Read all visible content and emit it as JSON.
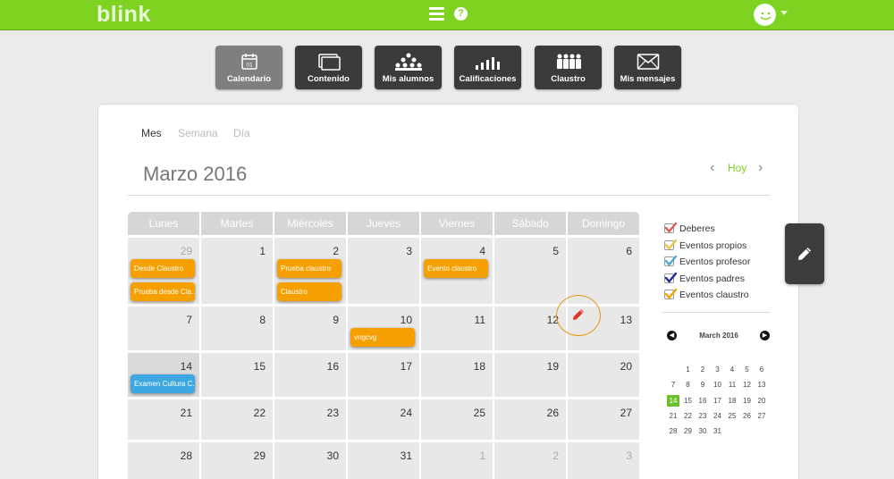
{
  "app": {
    "logo": "blink"
  },
  "nav": {
    "items": [
      {
        "label": "Calendario",
        "icon": "calendar-icon",
        "active": true,
        "icon_text": "01"
      },
      {
        "label": "Contenido",
        "icon": "content-icon",
        "active": false
      },
      {
        "label": "Mis alumnos",
        "icon": "students-icon",
        "active": false
      },
      {
        "label": "Calificaciones",
        "icon": "grades-icon",
        "active": false
      },
      {
        "label": "Claustro",
        "icon": "faculty-icon",
        "active": false
      },
      {
        "label": "Mis mensajes",
        "icon": "messages-icon",
        "active": false
      }
    ]
  },
  "calendar": {
    "views": [
      "Mes",
      "Semana",
      "Día"
    ],
    "active_view": "Mes",
    "title": "Marzo 2016",
    "today_label": "Hoy",
    "weekdays": [
      "Lunes",
      "Martes",
      "Miércoles",
      "Jueves",
      "Viernes",
      "Sábado",
      "Domingo"
    ],
    "weeks": [
      [
        {
          "day": "29",
          "other": true,
          "events": [
            {
              "label": "Desde Claustro",
              "color": "orange"
            },
            {
              "label": "Prueba desde Cla...",
              "color": "orange"
            }
          ]
        },
        {
          "day": "1"
        },
        {
          "day": "2",
          "events": [
            {
              "label": "Prueba claustro",
              "color": "orange"
            },
            {
              "label": "Claustro",
              "color": "orange"
            }
          ]
        },
        {
          "day": "3"
        },
        {
          "day": "4",
          "events": [
            {
              "label": "Evento claustro",
              "color": "orange"
            }
          ]
        },
        {
          "day": "5"
        },
        {
          "day": "6"
        }
      ],
      [
        {
          "day": "7"
        },
        {
          "day": "8"
        },
        {
          "day": "9"
        },
        {
          "day": "10",
          "events": [
            {
              "label": "vngcvg",
              "color": "orange"
            }
          ]
        },
        {
          "day": "11"
        },
        {
          "day": "12"
        },
        {
          "day": "13"
        }
      ],
      [
        {
          "day": "14",
          "today": true,
          "events": [
            {
              "label": "Examen Cultura C...",
              "color": "blue"
            }
          ]
        },
        {
          "day": "15"
        },
        {
          "day": "16"
        },
        {
          "day": "17"
        },
        {
          "day": "18"
        },
        {
          "day": "19"
        },
        {
          "day": "20"
        }
      ],
      [
        {
          "day": "21"
        },
        {
          "day": "22"
        },
        {
          "day": "23"
        },
        {
          "day": "24"
        },
        {
          "day": "25"
        },
        {
          "day": "26"
        },
        {
          "day": "27"
        }
      ],
      [
        {
          "day": "28"
        },
        {
          "day": "29"
        },
        {
          "day": "30"
        },
        {
          "day": "31"
        },
        {
          "day": "1",
          "other": true
        },
        {
          "day": "2",
          "other": true
        },
        {
          "day": "3",
          "other": true
        }
      ]
    ]
  },
  "legend": [
    {
      "label": "Deberes",
      "color": "#e05a5a"
    },
    {
      "label": "Eventos propios",
      "color": "#e8c64a"
    },
    {
      "label": "Eventos profesor",
      "color": "#4aa8d8"
    },
    {
      "label": "Eventos padres",
      "color": "#1e2a9a"
    },
    {
      "label": "Eventos claustro",
      "color": "#f5a000"
    }
  ],
  "mini_calendar": {
    "title": "March 2016",
    "rows": [
      [
        "",
        "1",
        "2",
        "3",
        "4",
        "5",
        "6"
      ],
      [
        "7",
        "8",
        "9",
        "10",
        "11",
        "12",
        "13"
      ],
      [
        "14",
        "15",
        "16",
        "17",
        "18",
        "19",
        "20"
      ],
      [
        "21",
        "22",
        "23",
        "24",
        "25",
        "26",
        "27"
      ],
      [
        "28",
        "29",
        "30",
        "31",
        "",
        "",
        ""
      ]
    ],
    "selected": "14"
  },
  "colors": {
    "brand": "#7ed321",
    "event_orange": "#f5a000",
    "event_blue": "#3ca7e0"
  }
}
